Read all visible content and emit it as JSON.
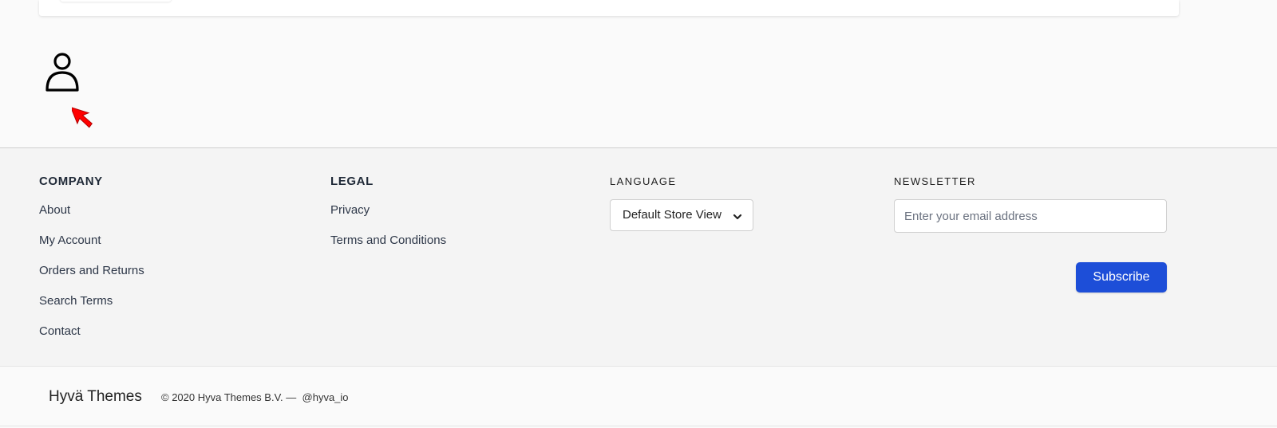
{
  "footer": {
    "company": {
      "heading": "COMPANY",
      "links": [
        "About",
        "My Account",
        "Orders and Returns",
        "Search Terms",
        "Contact"
      ]
    },
    "legal": {
      "heading": "LEGAL",
      "links": [
        "Privacy",
        "Terms and Conditions"
      ]
    },
    "language": {
      "heading": "LANGUAGE",
      "selected": "Default Store View"
    },
    "newsletter": {
      "heading": "NEWSLETTER",
      "placeholder": "Enter your email address",
      "button_label": "Subscribe"
    }
  },
  "bottom_bar": {
    "brand": "Hyvä Themes",
    "copyright": "© 2020 Hyva Themes B.V. —",
    "handle": "@hyva_io"
  },
  "icons": {
    "account": "user-icon",
    "chevron": "chevron-down-icon",
    "cursor": "cursor-arrow-icon"
  },
  "colors": {
    "accent": "#1d4ed8",
    "cursor": "#ff0000"
  }
}
